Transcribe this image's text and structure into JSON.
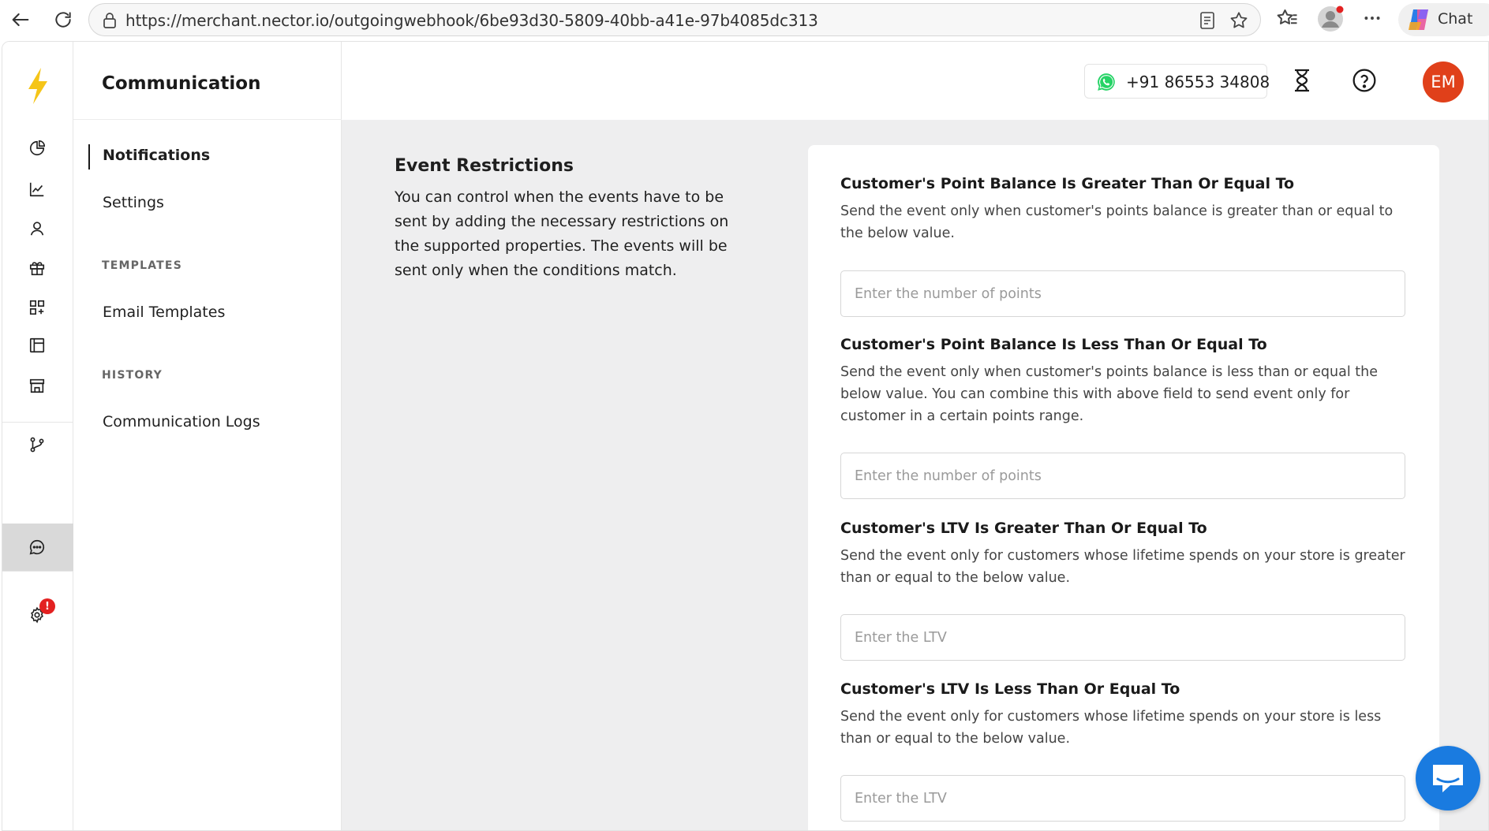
{
  "browser": {
    "url": "https://merchant.nector.io/outgoingwebhook/6be93d30-5809-40bb-a41e-97b4085dc313",
    "chat_label": "Chat"
  },
  "subnav": {
    "title": "Communication",
    "items": [
      {
        "label": "Notifications",
        "active": true
      },
      {
        "label": "Settings"
      }
    ],
    "sections": [
      {
        "title": "TEMPLATES",
        "items": [
          {
            "label": "Email Templates"
          }
        ]
      },
      {
        "title": "HISTORY",
        "items": [
          {
            "label": "Communication Logs"
          }
        ]
      }
    ]
  },
  "rail": {
    "settings_badge": "!"
  },
  "topbar": {
    "phone": "+91 86553 34808",
    "avatar_initials": "EM",
    "avatar_color": "#e0401a"
  },
  "intro": {
    "heading": "Event Restrictions",
    "text": "You can control when the events have to be sent by adding the necessary restrictions on the supported properties. The events will be sent only when the conditions match."
  },
  "fields": [
    {
      "label": "Customer's Point Balance Is Greater Than Or Equal To",
      "description": "Send the event only when customer's points balance is greater than or equal to the below value.",
      "placeholder": "Enter the number of points",
      "value": ""
    },
    {
      "label": "Customer's Point Balance Is Less Than Or Equal To",
      "description": "Send the event only when customer's points balance is less than or equal the below value. You can combine this with above field to send event only for customer in a certain points range.",
      "placeholder": "Enter the number of points",
      "value": ""
    },
    {
      "label": "Customer's LTV Is Greater Than Or Equal To",
      "description": "Send the event only for customers whose lifetime spends on your store is greater than or equal to the below value.",
      "placeholder": "Enter the LTV",
      "value": ""
    },
    {
      "label": "Customer's LTV Is Less Than Or Equal To",
      "description": "Send the event only for customers whose lifetime spends on your store is less than or equal to the below value.",
      "placeholder": "Enter the LTV",
      "value": ""
    }
  ],
  "colors": {
    "brand_bolt": "#f5c518",
    "whatsapp": "#25d366",
    "chat_fab": "#1a7be0",
    "badge": "#e32121"
  }
}
